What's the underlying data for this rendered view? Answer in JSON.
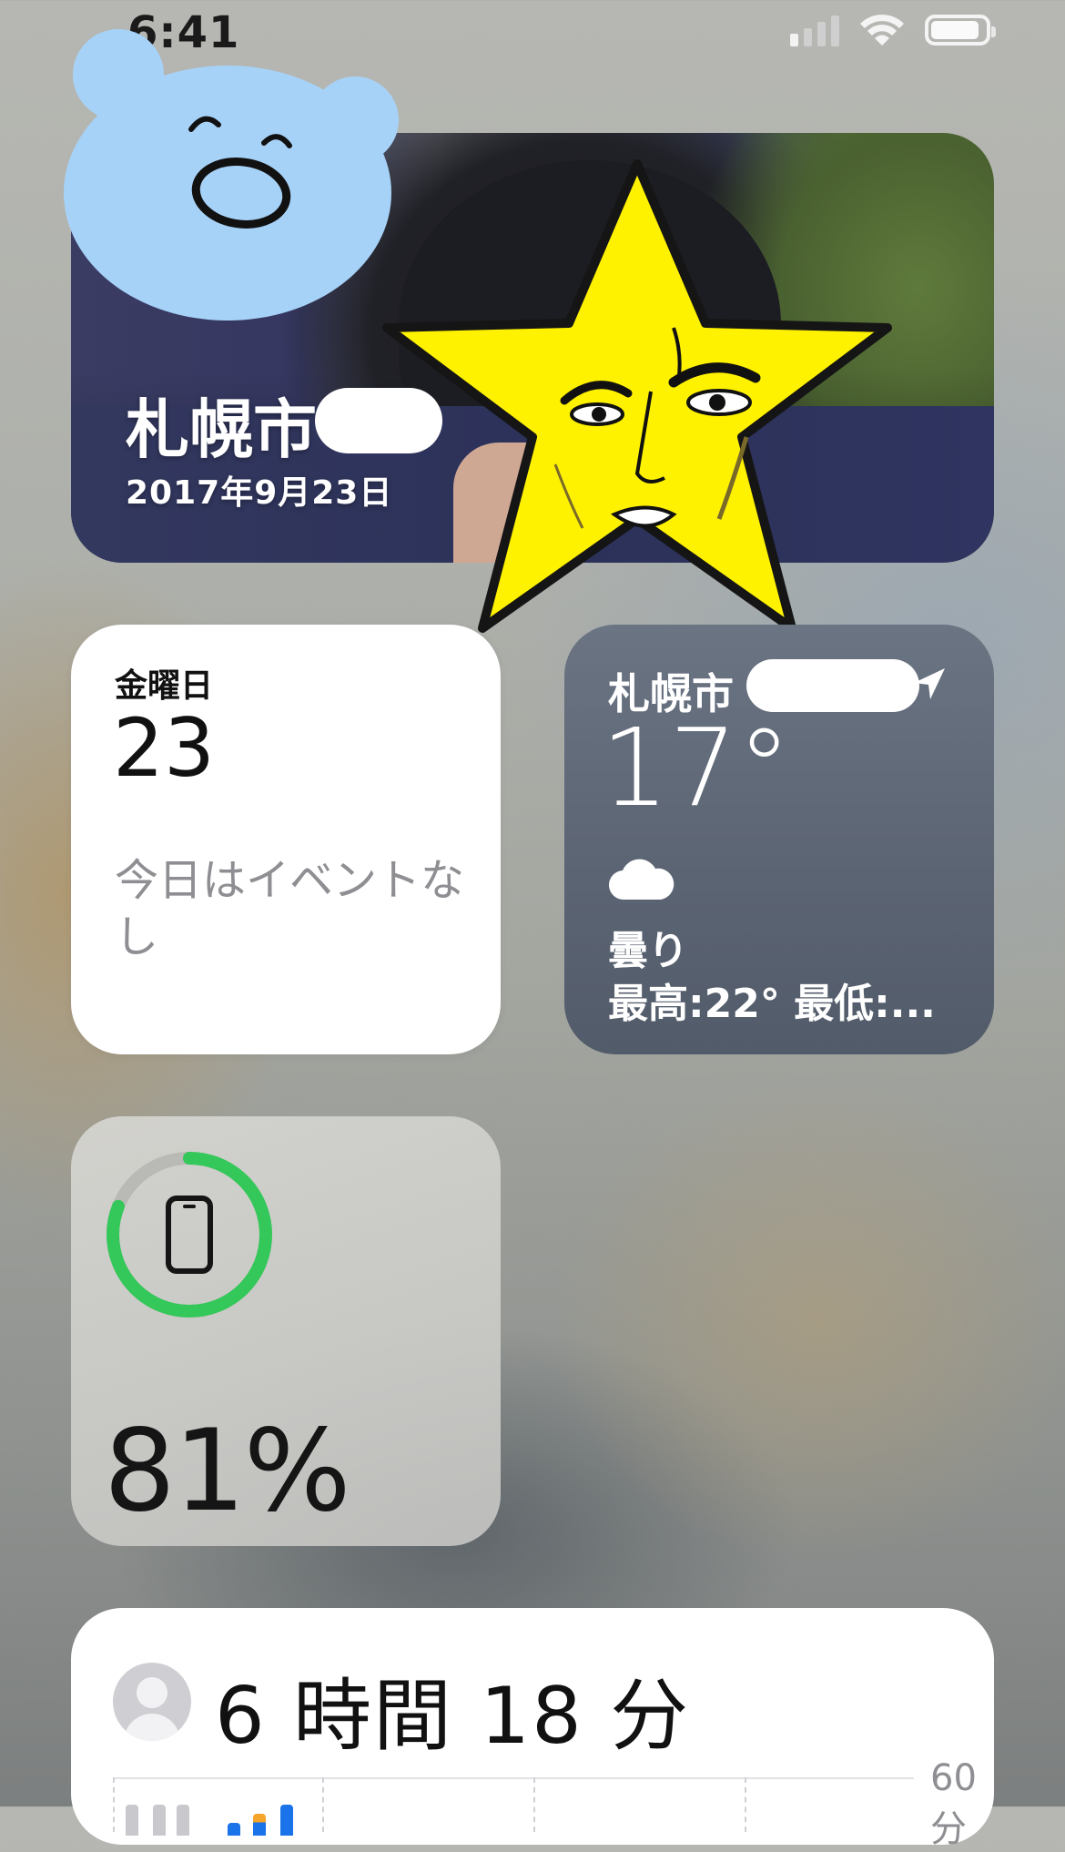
{
  "status_bar": {
    "time": "6:41",
    "signal_bars_on": 1,
    "signal_bars_total": 4,
    "battery_level": 0.9
  },
  "photo_widget": {
    "location": "札幌市",
    "date": "2017年9月23日"
  },
  "calendar_widget": {
    "weekday": "金曜日",
    "day": "23",
    "no_events": "今日はイベントなし"
  },
  "weather_widget": {
    "location": "札幌市",
    "temperature": "17°",
    "condition_icon": "cloud-icon",
    "condition": "曇り",
    "high_low": "最高:22° 最低:..."
  },
  "battery_widget": {
    "device_icon": "iphone-icon",
    "percent": "81%",
    "level": 0.81,
    "ring_color": "#34c759"
  },
  "screen_time_widget": {
    "total": "6 時間 18 分",
    "axis_label": "60 分"
  },
  "colors": {
    "accent_green": "#34c759",
    "screen_time_blue": "#1a73e8"
  }
}
